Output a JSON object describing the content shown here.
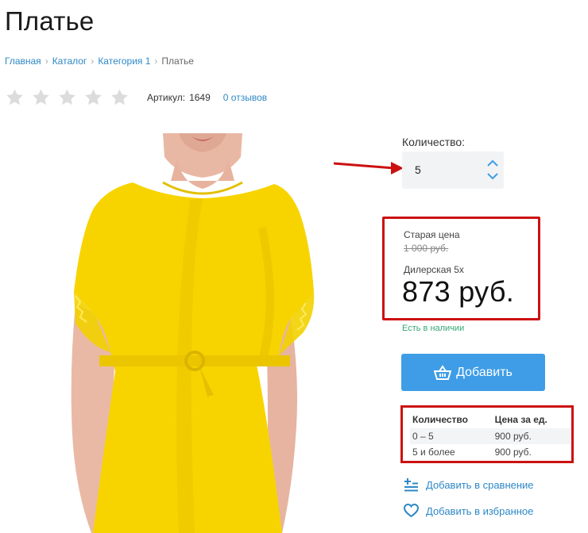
{
  "page": {
    "title": "Платье"
  },
  "breadcrumb": [
    {
      "label": "Главная",
      "link": true
    },
    {
      "label": "Каталог",
      "link": true
    },
    {
      "label": "Категория 1",
      "link": true
    },
    {
      "label": "Платье",
      "link": false
    }
  ],
  "rating": {
    "stars_total": 5,
    "stars_filled": 0,
    "star_color": "#dcdcdc"
  },
  "sku": {
    "label": "Артикул:",
    "value": "1649"
  },
  "reviews_link": "0 отзывов",
  "quantity": {
    "label": "Количество:",
    "value": "5"
  },
  "price": {
    "old_label": "Старая цена",
    "old_value": "1 000 руб.",
    "dealer_label": "Дилерская 5х",
    "current": "873 руб."
  },
  "stock_status": "Есть в наличии",
  "add_button": {
    "label": "Добавить"
  },
  "price_table": {
    "headers": [
      "Количество",
      "Цена за ед."
    ],
    "rows": [
      [
        "0 – 5",
        "900 руб."
      ],
      [
        "5 и более",
        "900 руб."
      ]
    ]
  },
  "actions": {
    "compare": "Добавить в сравнение",
    "favorite": "Добавить в избранное"
  },
  "colors": {
    "accent": "#3e9de6",
    "link": "#2e88c7",
    "in_stock": "#38a873",
    "annotation_red": "#cc1111",
    "dress_yellow": "#f7d400"
  },
  "icons": [
    "star-icon",
    "chevron-up-icon",
    "chevron-down-icon",
    "basket-icon",
    "compare-icon",
    "heart-icon",
    "annotation-arrow-icon"
  ]
}
